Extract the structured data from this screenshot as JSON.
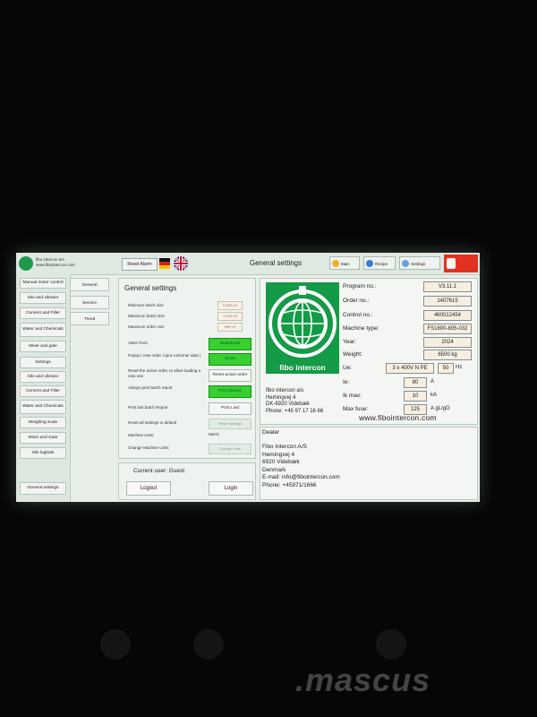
{
  "topbar": {
    "company_line1": "fibo intercon a/s",
    "company_line2": "www.fibointercon.com",
    "reset_alarm": "Reset Alarm",
    "title": "General settings",
    "btn_main": "Main",
    "btn_recipe": "Recipe",
    "btn_settings": "Settings"
  },
  "sidebar": {
    "items": [
      "Manual motor control",
      "Silo and vibrator",
      "Cement and Filler",
      "Water and Chemicals",
      "Mixer and gate",
      "Settings",
      "Silo and vibrator",
      "Cement and Filler",
      "Water and Chemicals",
      "Weighing scale",
      "Mixer and Gate",
      "Silo legbale",
      "General settings"
    ],
    "sub": [
      "General",
      "Service",
      "Trend"
    ]
  },
  "general": {
    "heading": "General settings",
    "min_batch_label": "Minimum batch size",
    "max_batch_label": "Maximum batch size",
    "max_order_label": "Maximum order size",
    "min_batch_val": "0,300 m³",
    "max_batch_val": "1,000 m³",
    "max_order_val": "999 m³",
    "alarm_label": "Alarm horn",
    "alarm_btn": "Deactivate",
    "popup_label": "Popup ( new order, input customer data )",
    "popup_btn": "Show",
    "reset_label": "Reset the active order, to allow loading a new one",
    "reset_btn": "Reset active order",
    "always_print_label": "Always print batch report",
    "always_print_btn": "Print always",
    "print_last_label": "Print last batch Report",
    "print_last_btn": "Print Last",
    "reset_default_label": "Reset all settings to default",
    "reset_default_btn": "Reset settings",
    "machine_units_label": "Machine Units",
    "machine_units_val": "Metric",
    "change_units_label": "Change Machine Units",
    "change_units_btn": "Change units"
  },
  "user": {
    "current": "Current user: Guest",
    "logout": "Logout",
    "login": "Login"
  },
  "info": {
    "brand": "fibo intercon",
    "address": [
      "fibo intercon a/s",
      "Hemingvej 4",
      "DK-6920 Videbæk",
      "Phone: +45 97 17 16 66"
    ],
    "program_label": "Program no.:",
    "program": "V3.11.1",
    "order_label": "Order no.:",
    "order": "1407615",
    "control_label": "Control no.:",
    "control": "460012454",
    "type_label": "Machine type:",
    "type": "FS1800-805-032",
    "year_label": "Year:",
    "year": "2024",
    "weight_label": "Weight:",
    "weight": "6500 kg",
    "ue_label": "Ue:",
    "ue": "3 x 400V N PE",
    "hz": "50",
    "hz_unit": "Hz",
    "ie_label": "Ie:",
    "ie": "80",
    "ie_unit": "A",
    "ik_label": "Ik max:",
    "ik": "10",
    "ik_unit": "kA",
    "fuse_label": "Max fuse:",
    "fuse": "125",
    "fuse_unit": "A gL/gG",
    "website": "www.fibointercon.com"
  },
  "dealer": {
    "heading": "Dealer",
    "lines": [
      "Fibo Intercon A/S",
      "Hemingvej 4",
      "6920 Videbæk",
      "Denmark",
      "E-mail: info@fibointercon.com",
      "Phone: +45971/1666"
    ]
  },
  "watermark": ".mascus"
}
